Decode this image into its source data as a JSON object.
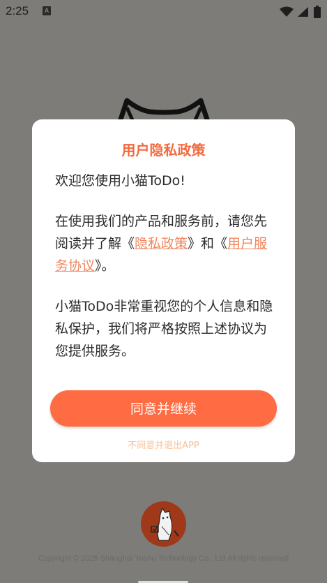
{
  "status_bar": {
    "time": "2:25",
    "notification_icon_letter": "A",
    "icons": [
      "wifi-icon",
      "signal-icon",
      "battery-icon"
    ]
  },
  "dialog": {
    "title": "用户隐私政策",
    "greeting": "欢迎您使用小猫ToDo!",
    "intro_before": "在使用我们的产品和服务前，请您先阅读并了解《",
    "privacy_link": "隐私政策",
    "intro_middle": "》和《",
    "service_link": "用户服务协议",
    "intro_after": "》。",
    "closing": "小猫ToDo非常重视您的个人信息和隐私保护，我们将严格按照上述协议为您提供服务。",
    "agree_label": "同意并继续",
    "decline_label": "不同意并退出APP"
  },
  "footer": {
    "copyright": "Copyright © 2025 Shanghai Yushu Technology Co., Ltd All rights reserved"
  },
  "colors": {
    "accent": "#ff6b42",
    "title": "#f26a3d",
    "link": "#f0865d",
    "decline": "#f5c09a",
    "scrim": "#7d7c79",
    "logo_bg": "#a0391a"
  }
}
